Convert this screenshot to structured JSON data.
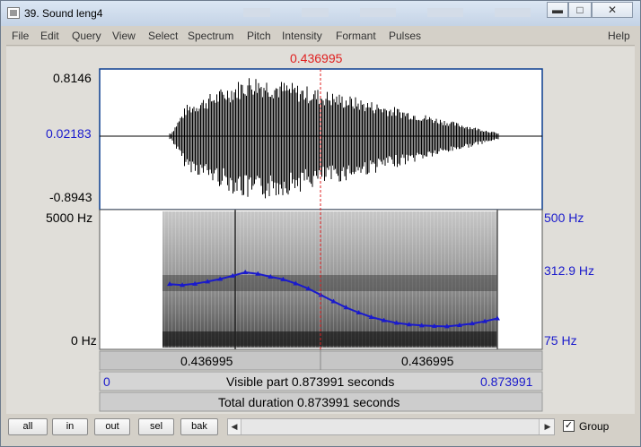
{
  "window": {
    "title": "39. Sound leng4"
  },
  "menubar": {
    "items": [
      "File",
      "Edit",
      "Query",
      "View",
      "Select",
      "Spectrum",
      "Pitch",
      "Intensity",
      "Formant",
      "Pulses"
    ],
    "help": "Help"
  },
  "waveform": {
    "cursor_time": "0.436995",
    "y_max": "0.8146",
    "y_zero": "0.02183",
    "y_min": "-0.8943"
  },
  "spectrogram": {
    "freq_top": "5000 Hz",
    "freq_bottom": "0 Hz"
  },
  "pitch": {
    "top": "500 Hz",
    "mid": "312.9 Hz",
    "bottom": "75 Hz",
    "contour_hz": [
      273,
      270,
      274,
      281,
      289,
      299,
      310,
      305,
      296,
      288,
      275,
      259,
      239,
      219,
      200,
      184,
      170,
      160,
      152,
      147,
      144,
      142,
      141,
      145,
      150,
      157,
      166
    ]
  },
  "timebar": {
    "left_segment": "0.436995",
    "right_segment": "0.436995",
    "visible_start": "0",
    "visible_label": "Visible part 0.873991 seconds",
    "visible_end": "0.873991",
    "total_label": "Total duration 0.873991 seconds"
  },
  "bottombar": {
    "buttons": [
      "all",
      "in",
      "out",
      "sel",
      "bak"
    ],
    "group_label": "Group",
    "group_checked": true
  },
  "colors": {
    "cursor": "#e02020",
    "axis_value": "#1a1acc",
    "pitch": "#1a1acc"
  }
}
